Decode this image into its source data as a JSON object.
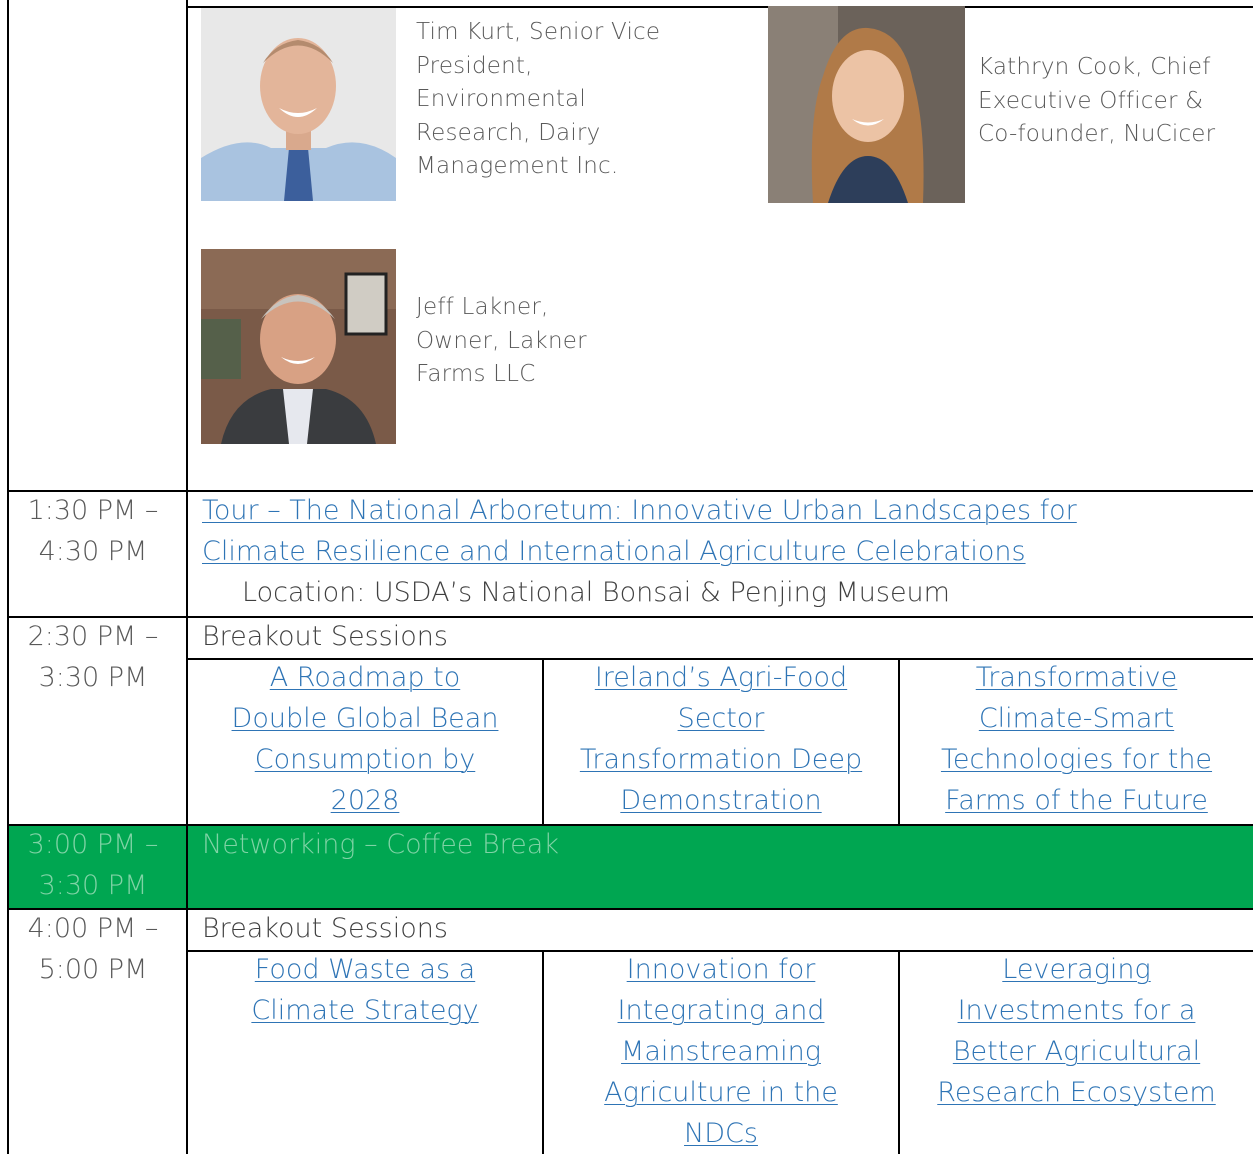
{
  "speakers": [
    {
      "name_bio": "Tim Kurt, Senior Vice President, Environmental Research, Dairy Management Inc.",
      "lines": [
        "Tim Kurt, Senior Vice",
        "President,",
        "Environmental",
        "Research, Dairy",
        "Management Inc."
      ]
    },
    {
      "name_bio": "Kathryn Cook, Chief Executive Officer & Co-founder, NuCicer",
      "lines": [
        "Kathryn Cook, Chief",
        "Executive Officer &",
        "Co-founder, NuCicer"
      ]
    },
    {
      "name_bio": "Jeff Lakner, Owner, Lakner Farms LLC",
      "lines": [
        "Jeff Lakner,",
        "Owner, Lakner",
        "Farms LLC"
      ]
    }
  ],
  "rows": {
    "tour": {
      "time": [
        "1:30 PM –",
        "4:30 PM"
      ],
      "title_lines": [
        "Tour – The National Arboretum: Innovative Urban Landscapes for",
        "Climate Resilience and International Agriculture Celebrations"
      ],
      "location": "Location: USDA’s National Bonsai & Penjing Museum"
    },
    "breakout1": {
      "time": [
        "2:30 PM –",
        "3:30 PM"
      ],
      "heading": "Breakout Sessions",
      "sessions": [
        [
          "A Roadmap to",
          "Double Global Bean",
          "Consumption by",
          "2028"
        ],
        [
          "Ireland’s Agri-Food",
          "Sector",
          "Transformation Deep",
          "Demonstration"
        ],
        [
          "Transformative",
          "Climate-Smart",
          "Technologies for the",
          "Farms of the Future"
        ]
      ]
    },
    "networking": {
      "time": [
        "3:00 PM –",
        "3:30 PM"
      ],
      "title": "Networking – Coffee Break",
      "color": "#00a651"
    },
    "breakout2": {
      "time": [
        "4:00 PM –",
        "5:00 PM"
      ],
      "heading": "Breakout Sessions",
      "sessions": [
        [
          "Food Waste as a",
          "Climate Strategy"
        ],
        [
          "Innovation for",
          "Integrating and",
          "Mainstreaming",
          "Agriculture in the",
          "NDCs"
        ],
        [
          "Leveraging",
          "Investments for a",
          "Better Agricultural",
          "Research Ecosystem"
        ]
      ]
    }
  }
}
